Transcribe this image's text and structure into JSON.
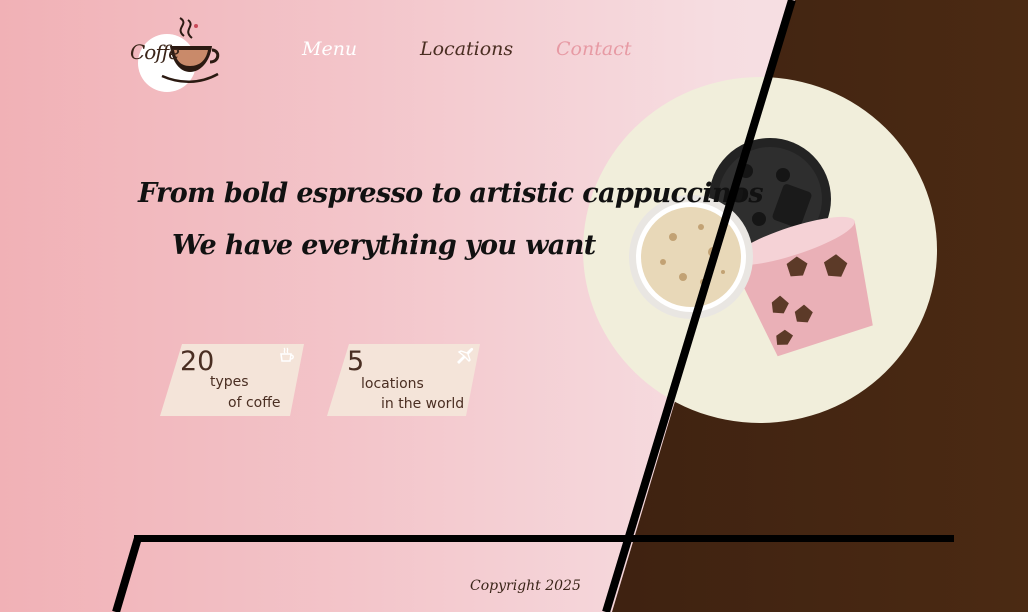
{
  "logo": {
    "text": "Coffe"
  },
  "nav": {
    "menu": "Menu",
    "locations": "Locations",
    "contact": "Contact"
  },
  "hero": {
    "line1": "From bold espresso to artistic cappuccinos",
    "line2": "We have everything you want"
  },
  "stats": [
    {
      "number": "20",
      "line1": "types",
      "line2": "of coffe",
      "icon": "coffee-cup-icon"
    },
    {
      "number": "5",
      "line1": "locations",
      "line2": "in the world",
      "icon": "airplane-icon"
    }
  ],
  "footer": {
    "copyright": "Copyright 2025"
  },
  "colors": {
    "pink": "#f1b1b6",
    "brown": "#3a1f10",
    "cream": "#f1eedb",
    "accent": "#e79aa4"
  }
}
